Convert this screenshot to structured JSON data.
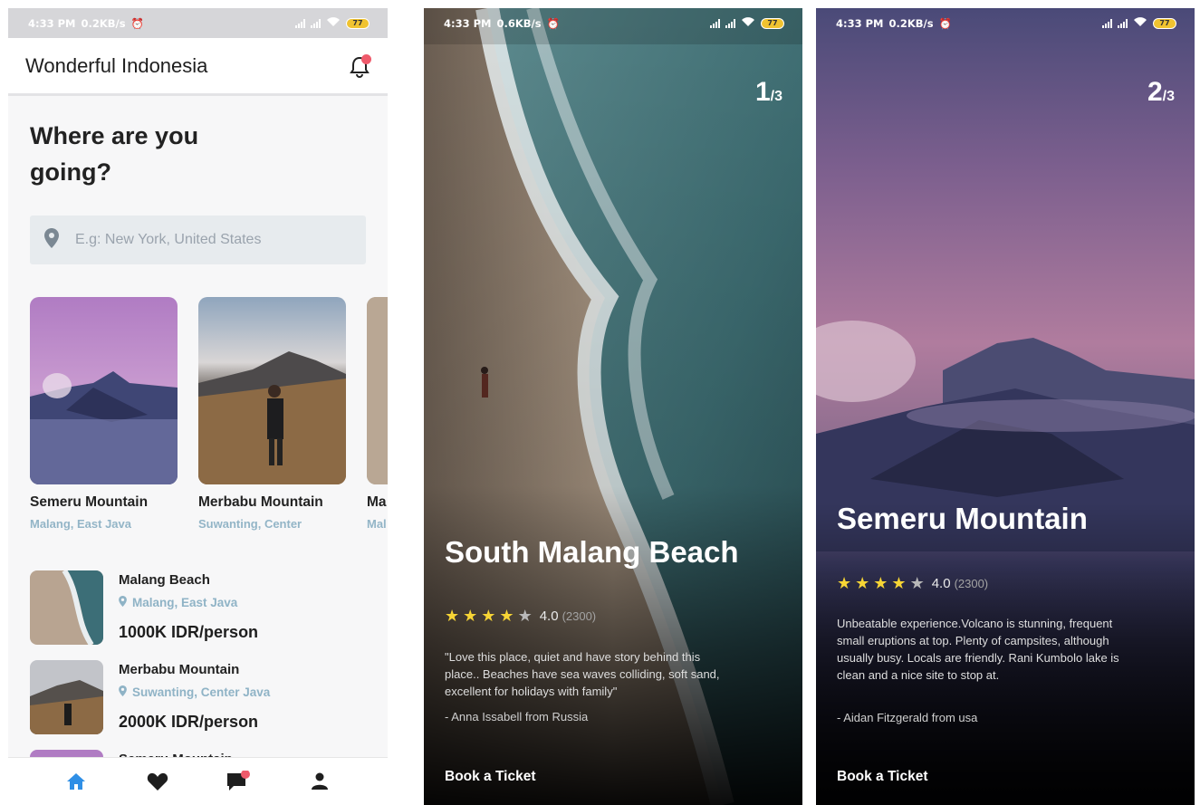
{
  "status_bar": {
    "screen1": {
      "time": "4:33 PM",
      "speed": "0.2KB/s",
      "battery": "77"
    },
    "screen2": {
      "time": "4:33 PM",
      "speed": "0.6KB/s",
      "battery": "77"
    },
    "screen3": {
      "time": "4:33 PM",
      "speed": "0.2KB/s",
      "battery": "77"
    }
  },
  "home": {
    "app_title": "Wonderful Indonesia",
    "headline": "Where are you going?",
    "search_placeholder": "E.g: New York, United States",
    "cards": [
      {
        "name": "Semeru Mountain",
        "location": "Malang, East Java"
      },
      {
        "name": "Merbabu Mountain",
        "location": "Suwanting, Center"
      },
      {
        "name": "Ma",
        "location": "Mal"
      }
    ],
    "list": [
      {
        "name": "Malang Beach",
        "location": "Malang, East Java",
        "price": "1000K IDR/person"
      },
      {
        "name": "Merbabu Mountain",
        "location": "Suwanting, Center Java",
        "price": "2000K IDR/person"
      },
      {
        "name": "Semeru Mountain"
      }
    ],
    "nav": [
      "home-icon",
      "heart-icon",
      "chat-icon",
      "profile-icon"
    ]
  },
  "detail1": {
    "pager_current": "1",
    "pager_total": "/3",
    "title": "South Malang Beach",
    "rating": 4,
    "score": "4.0",
    "count": "(2300)",
    "review": "\"Love this place, quiet and have story behind this place.. Beaches have sea waves colliding, soft sand, excellent for holidays with family\"",
    "author": "- Anna Issabell from Russia",
    "book_label": "Book a Ticket"
  },
  "detail2": {
    "pager_current": "2",
    "pager_total": "/3",
    "title": "Semeru Mountain",
    "rating": 4,
    "score": "4.0",
    "count": "(2300)",
    "review": "Unbeatable experience.Volcano is stunning, frequent small eruptions at top. Plenty of campsites, although usually busy. Locals are friendly. Rani Kumbolo lake is clean and a nice site to stop at.",
    "author": "- Aidan Fitzgerald from usa",
    "book_label": "Book a Ticket"
  },
  "colors": {
    "accent": "#2f8fe6",
    "notification": "#ef5a6b",
    "star": "#f7d535",
    "location": "#8fb3c6"
  }
}
